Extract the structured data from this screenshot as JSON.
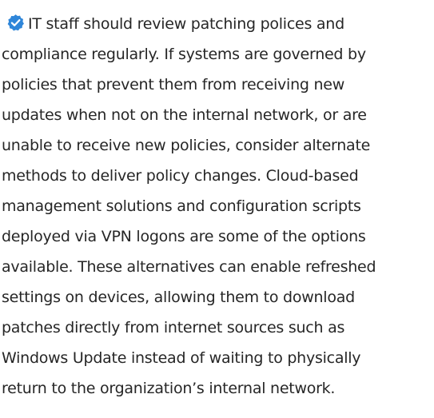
{
  "note": {
    "icon": "verified-check-icon",
    "accent_color": "#2f86d9",
    "text_color": "#262626",
    "lines": [
      "IT staff should review patching polices and",
      "compliance regularly. If systems are governed by",
      "policies that prevent them from receiving new",
      "updates when not on the internal network, or are",
      "unable to receive new policies, consider alternate",
      "methods to deliver policy changes. Cloud-based",
      "management solutions and configuration scripts",
      "deployed via VPN logons are some of the options",
      "available. These alternatives can enable refreshed",
      "settings on devices, allowing them to download",
      "patches directly from internet sources such as",
      "Windows Update instead of waiting to physically",
      "return to the organization’s internal network."
    ]
  }
}
